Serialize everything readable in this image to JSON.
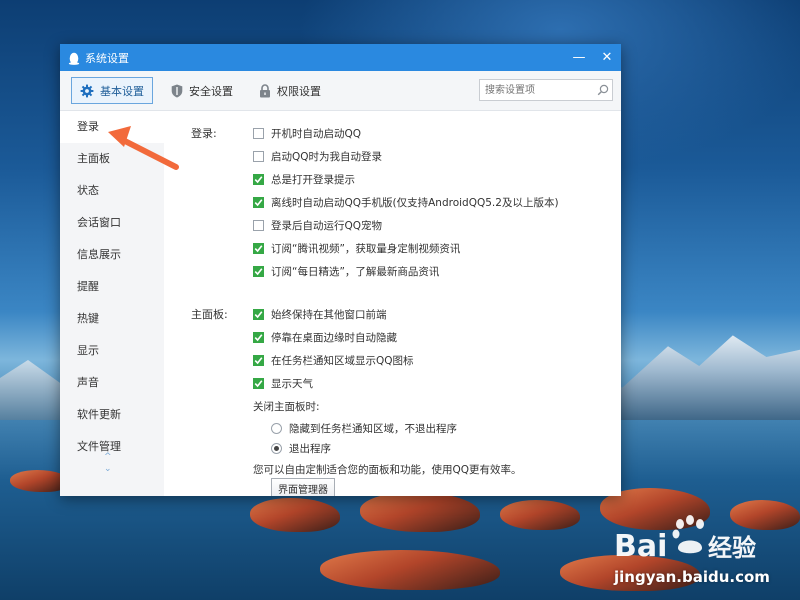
{
  "window": {
    "title": "系统设置",
    "controls": {
      "minimize": "—",
      "close": "✕"
    }
  },
  "toolbar": {
    "tabs": [
      {
        "label": "基本设置",
        "icon": "gear-icon",
        "active": true
      },
      {
        "label": "安全设置",
        "icon": "shield-icon",
        "active": false
      },
      {
        "label": "权限设置",
        "icon": "lock-icon",
        "active": false
      }
    ],
    "search": {
      "placeholder": "搜索设置项",
      "value": ""
    }
  },
  "sidebar": {
    "items": [
      {
        "label": "登录",
        "active": true
      },
      {
        "label": "主面板"
      },
      {
        "label": "状态"
      },
      {
        "label": "会话窗口"
      },
      {
        "label": "信息展示"
      },
      {
        "label": "提醒"
      },
      {
        "label": "热键"
      },
      {
        "label": "显示"
      },
      {
        "label": "声音"
      },
      {
        "label": "软件更新"
      },
      {
        "label": "文件管理"
      }
    ],
    "scroll_up": "^",
    "scroll_down": "⌄"
  },
  "login_section": {
    "label": "登录:",
    "options": [
      {
        "label": "开机时自动启动QQ",
        "checked": false
      },
      {
        "label": "启动QQ时为我自动登录",
        "checked": false
      },
      {
        "label": "总是打开登录提示",
        "checked": true
      },
      {
        "label": "离线时自动启动QQ手机版(仅支持AndroidQQ5.2及以上版本)",
        "checked": true
      },
      {
        "label": "登录后自动运行QQ宠物",
        "checked": false
      },
      {
        "label": "订阅“腾讯视频”，获取量身定制视频资讯",
        "checked": true
      },
      {
        "label": "订阅“每日精选”，了解最新商品资讯",
        "checked": true
      }
    ]
  },
  "main_panel_section": {
    "label": "主面板:",
    "options": [
      {
        "label": "始终保持在其他窗口前端",
        "checked": true
      },
      {
        "label": "停靠在桌面边缘时自动隐藏",
        "checked": true
      },
      {
        "label": "在任务栏通知区域显示QQ图标",
        "checked": true
      },
      {
        "label": "显示天气",
        "checked": true
      }
    ],
    "close_label": "关闭主面板时:",
    "close_options": [
      {
        "label": "隐藏到任务栏通知区域，不退出程序",
        "selected": false
      },
      {
        "label": "退出程序",
        "selected": true
      }
    ],
    "note": "您可以自由定制适合您的面板和功能，使用QQ更有效率。",
    "manager_button": "界面管理器"
  },
  "watermark": {
    "brand": "Baidu经验",
    "url": "jingyan.baidu.com"
  },
  "colors": {
    "titlebar": "#2a89e0",
    "checkbox_on": "#35a845",
    "annotation_arrow": "#f26a3b",
    "active_tab_border": "#6aa6de"
  }
}
